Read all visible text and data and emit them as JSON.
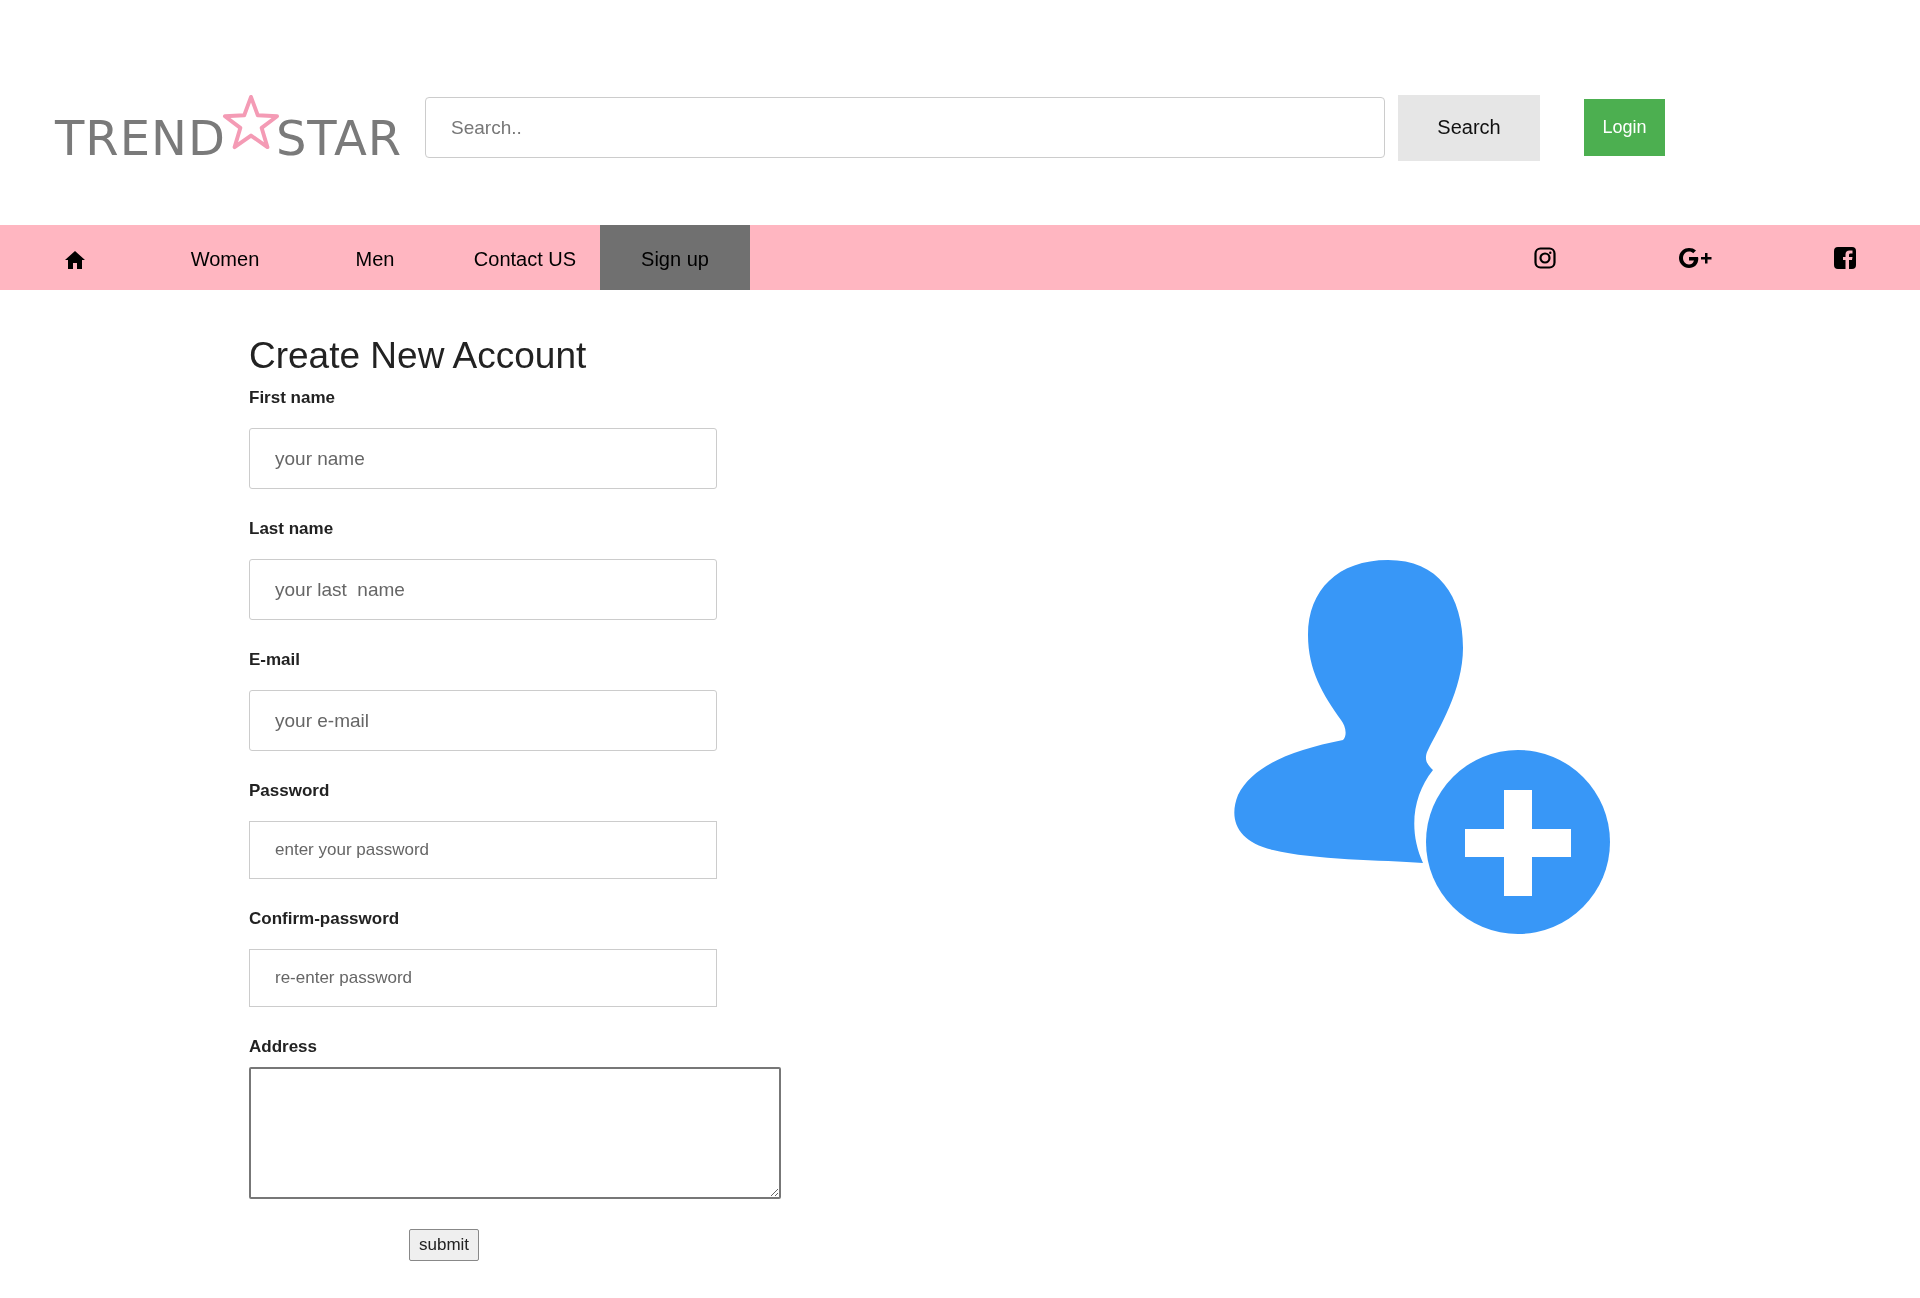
{
  "header": {
    "logo": {
      "left": "TREND",
      "right": "STAR"
    },
    "search": {
      "placeholder": "Search..",
      "button": "Search"
    },
    "login": "Login"
  },
  "nav": {
    "items": [
      {
        "kind": "home",
        "selected": false
      },
      {
        "kind": "link",
        "label": "Women",
        "selected": false
      },
      {
        "kind": "link",
        "label": "Men",
        "selected": false
      },
      {
        "kind": "link",
        "label": "Contact US",
        "selected": false
      },
      {
        "kind": "link",
        "label": "Sign up",
        "selected": true
      }
    ]
  },
  "form": {
    "title": "Create New Account",
    "fields": [
      {
        "kind": "text",
        "label": "First name",
        "placeholder": "your name"
      },
      {
        "kind": "text",
        "label": "Last name",
        "placeholder": "your last  name"
      },
      {
        "kind": "text",
        "label": "E-mail",
        "placeholder": "your e-mail"
      },
      {
        "kind": "password",
        "label": "Password",
        "placeholder": "enter your password"
      },
      {
        "kind": "password",
        "label": "Confirm-password",
        "placeholder": "re-enter password"
      },
      {
        "kind": "textarea",
        "label": "Address"
      }
    ],
    "submit": "submit"
  }
}
